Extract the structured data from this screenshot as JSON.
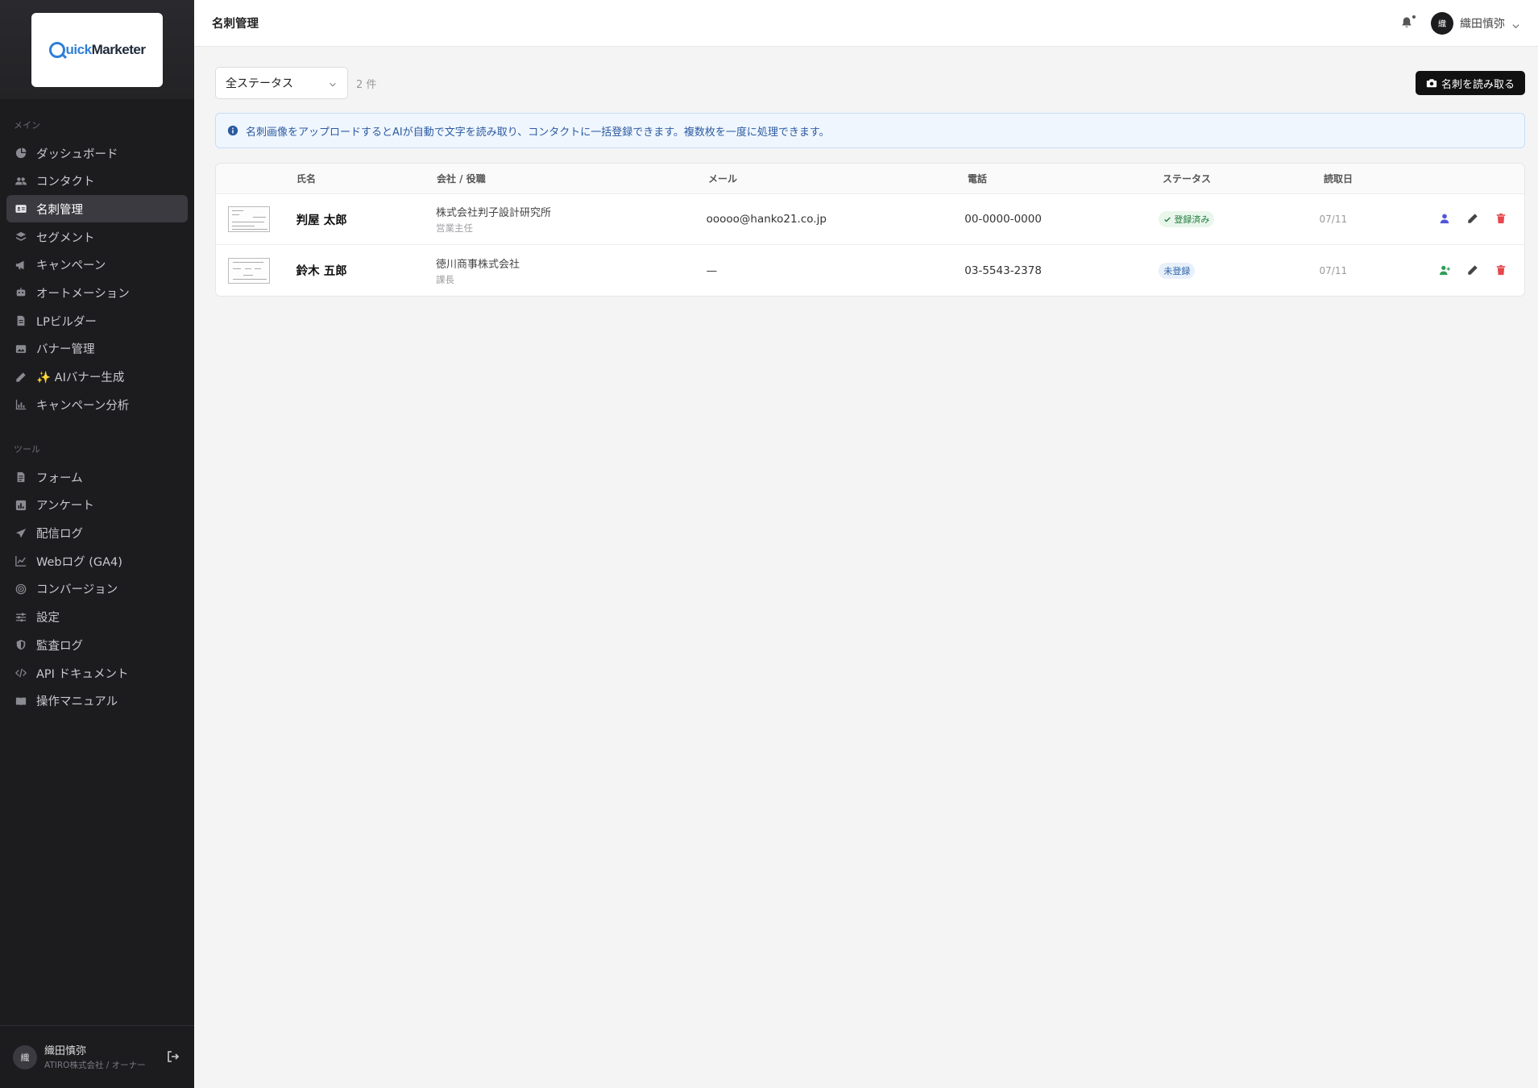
{
  "brand": {
    "logo_q": "",
    "logo_uick": "uick",
    "logo_marketer": " Marketer"
  },
  "sidebar": {
    "section_main": "メイン",
    "section_tools": "ツール",
    "main_items": [
      {
        "label": "ダッシュボード",
        "icon": "chart-pie-icon"
      },
      {
        "label": "コンタクト",
        "icon": "users-icon"
      },
      {
        "label": "名刺管理",
        "icon": "id-card-icon",
        "active": true
      },
      {
        "label": "セグメント",
        "icon": "layers-icon"
      },
      {
        "label": "キャンペーン",
        "icon": "megaphone-icon"
      },
      {
        "label": "オートメーション",
        "icon": "robot-icon"
      },
      {
        "label": "LPビルダー",
        "icon": "file-icon"
      },
      {
        "label": "バナー管理",
        "icon": "image-icon"
      },
      {
        "label": "✨ AIバナー生成",
        "icon": "pencil-icon"
      },
      {
        "label": "キャンペーン分析",
        "icon": "bar-chart-icon"
      }
    ],
    "tool_items": [
      {
        "label": "フォーム",
        "icon": "form-icon"
      },
      {
        "label": "アンケート",
        "icon": "poll-icon"
      },
      {
        "label": "配信ログ",
        "icon": "send-icon"
      },
      {
        "label": "Webログ (GA4)",
        "icon": "line-chart-icon"
      },
      {
        "label": "コンバージョン",
        "icon": "target-icon"
      },
      {
        "label": "設定",
        "icon": "sliders-icon"
      },
      {
        "label": "監査ログ",
        "icon": "shield-icon"
      },
      {
        "label": "API ドキュメント",
        "icon": "code-icon"
      },
      {
        "label": "操作マニュアル",
        "icon": "book-icon"
      }
    ],
    "footer": {
      "avatar": "織",
      "name": "織田慎弥",
      "org": "ATIRO株式会社 / オーナー"
    }
  },
  "header": {
    "title": "名刺管理",
    "user_avatar": "織",
    "user_name": "織田慎弥"
  },
  "toolbar": {
    "status_select": "全ステータス",
    "count": "2 件",
    "scan_button": "名刺を読み取る"
  },
  "info": {
    "text": "名刺画像をアップロードするとAIが自動で文字を読み取り、コンタクトに一括登録できます。複数枚を一度に処理できます。"
  },
  "table": {
    "headers": {
      "name": "氏名",
      "company": "会社 / 役職",
      "mail": "メール",
      "tel": "電話",
      "status": "ステータス",
      "date": "読取日"
    },
    "rows": [
      {
        "name": "判屋 太郎",
        "company": "株式会社判子設計研究所",
        "role": "営業主任",
        "mail": "ooooo@hanko21.co.jp",
        "tel": "00-0000-0000",
        "status": "登録済み",
        "date": "07/11"
      },
      {
        "name": "鈴木 五郎",
        "company": "徳川商事株式会社",
        "role": "課長",
        "mail": "—",
        "tel": "03-5543-2378",
        "status": "未登録",
        "date": "07/11"
      }
    ]
  },
  "colors": {
    "accent": "#111111",
    "info_bg": "#eff6fe",
    "registered": "#237a3b",
    "unregistered": "#2d63aa",
    "delete": "#e5484d",
    "view_user": "#4f56d8",
    "add_user": "#2f9e57"
  }
}
